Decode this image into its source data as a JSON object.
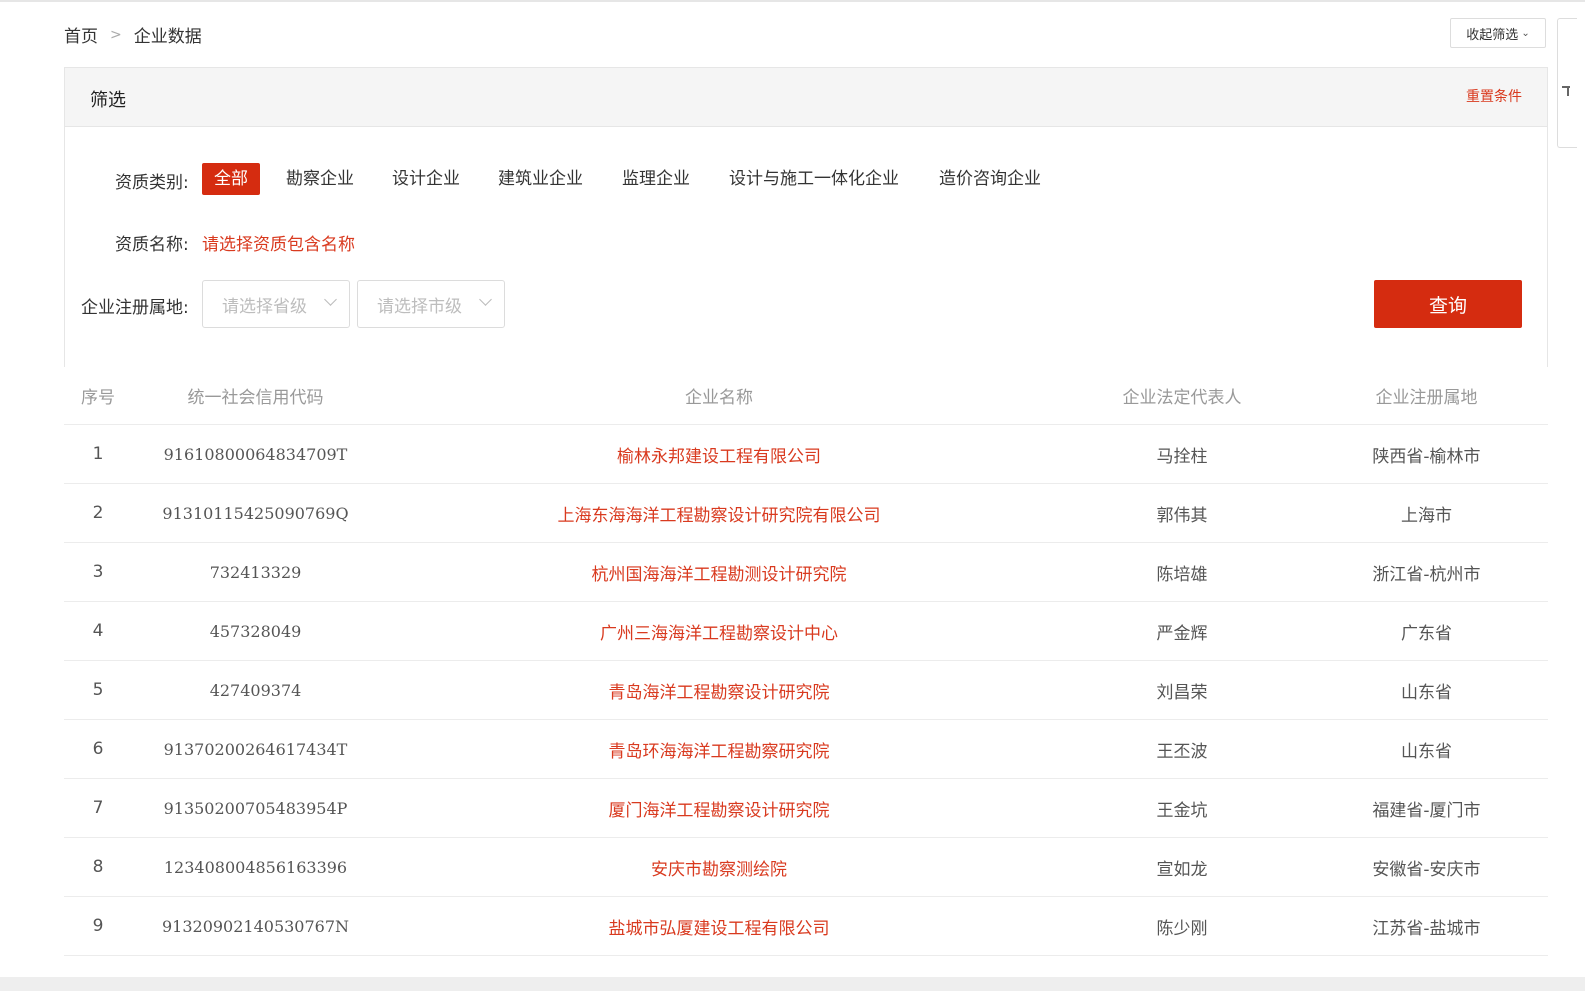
{
  "breadcrumb": {
    "home": "首页",
    "separator": ">",
    "current": "企业数据"
  },
  "collapse_button": {
    "label": "收起筛选",
    "icon": "chevron-down-icon"
  },
  "filter": {
    "title": "筛选",
    "reset_label": "重置条件",
    "category": {
      "label": "资质类别:",
      "options": [
        "全部",
        "勘察企业",
        "设计企业",
        "建筑业企业",
        "监理企业",
        "设计与施工一体化企业",
        "造价咨询企业"
      ],
      "selected": "全部"
    },
    "qualification_name": {
      "label": "资质名称:",
      "value": "请选择资质包含名称"
    },
    "region": {
      "label": "企业注册属地:",
      "province_placeholder": "请选择省级",
      "city_placeholder": "请选择市级"
    },
    "query_label": "查询"
  },
  "table": {
    "headers": [
      "序号",
      "统一社会信用代码",
      "企业名称",
      "企业法定代表人",
      "企业注册属地"
    ],
    "rows": [
      {
        "idx": "1",
        "code": "91610800064834709T",
        "name": "榆林永邦建设工程有限公司",
        "rep": "马拴柱",
        "loc": "陕西省-榆林市"
      },
      {
        "idx": "2",
        "code": "91310115425090769Q",
        "name": "上海东海海洋工程勘察设计研究院有限公司",
        "rep": "郭伟其",
        "loc": "上海市"
      },
      {
        "idx": "3",
        "code": "732413329",
        "name": "杭州国海海洋工程勘测设计研究院",
        "rep": "陈培雄",
        "loc": "浙江省-杭州市"
      },
      {
        "idx": "4",
        "code": "457328049",
        "name": "广州三海海洋工程勘察设计中心",
        "rep": "严金辉",
        "loc": "广东省"
      },
      {
        "idx": "5",
        "code": "427409374",
        "name": "青岛海洋工程勘察设计研究院",
        "rep": "刘昌荣",
        "loc": "山东省"
      },
      {
        "idx": "6",
        "code": "91370200264617434T",
        "name": "青岛环海海洋工程勘察研究院",
        "rep": "王丕波",
        "loc": "山东省"
      },
      {
        "idx": "7",
        "code": "91350200705483954P",
        "name": "厦门海洋工程勘察设计研究院",
        "rep": "王金坑",
        "loc": "福建省-厦门市"
      },
      {
        "idx": "8",
        "code": "123408004856163396",
        "name": "安庆市勘察测绘院",
        "rep": "宣如龙",
        "loc": "安徽省-安庆市"
      },
      {
        "idx": "9",
        "code": "91320902140530767N",
        "name": "盐城市弘厦建设工程有限公司",
        "rep": "陈少刚",
        "loc": "江苏省-盐城市"
      }
    ]
  },
  "colors": {
    "accent": "#d52c10",
    "link": "#d93a1f"
  }
}
